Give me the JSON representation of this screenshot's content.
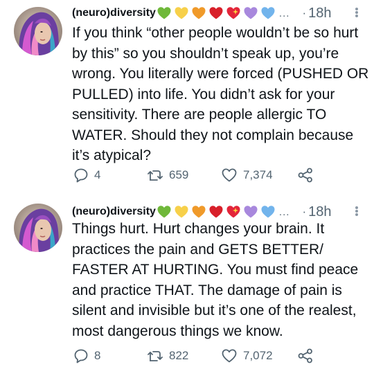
{
  "tweets": [
    {
      "display_name": "(neuro)diversity",
      "emojis": [
        "green-heart",
        "yellow-heart",
        "orange-heart",
        "red-heart",
        "sparkling-heart",
        "purple-heart",
        "blue-heart"
      ],
      "ellipsis": "...",
      "separator": "·",
      "time": "18h",
      "text": "If you think “other people wouldn’t be so hurt\nby this” so you shouldn’t speak up, you’re\nwrong. You literally were forced (PUSHED OR\nPULLED) into life. You didn’t ask for your\nsensitivity. There are people allergic TO\nWATER. Should they not complain because\nit’s atypical?",
      "replies": "4",
      "retweets": "659",
      "likes": "7,374"
    },
    {
      "display_name": "(neuro)diversity",
      "emojis": [
        "green-heart",
        "yellow-heart",
        "orange-heart",
        "red-heart",
        "sparkling-heart",
        "purple-heart",
        "blue-heart"
      ],
      "ellipsis": "...",
      "separator": "·",
      "time": "18h",
      "text": "Things hurt. Hurt changes your brain. It\npractices the pain and GETS BETTER/\nFASTER AT HURTING. You must find peace\nand practice THAT. The damage of pain is\nsilent and invisible but it’s one of the realest,\nmost dangerous things we know.",
      "replies": "8",
      "retweets": "822",
      "likes": "7,072"
    }
  ],
  "colors": {
    "text": "#0f1419",
    "secondary": "#536471",
    "green_heart": "#6fb83a",
    "yellow_heart": "#f7d04a",
    "orange_heart": "#f09a2a",
    "red_heart": "#d8202a",
    "sparkling_heart": "#e3253a",
    "purple_heart": "#a888dd",
    "blue_heart": "#72b4ec"
  }
}
